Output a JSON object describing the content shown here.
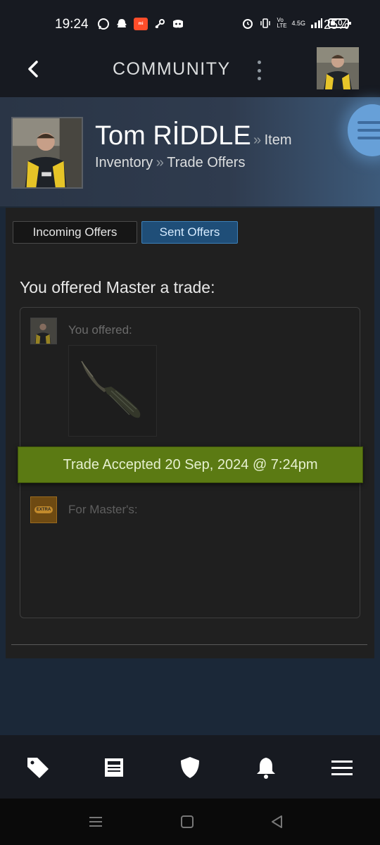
{
  "status_bar": {
    "time": "19:24",
    "network": "4.5G",
    "volte": "Vo LTE",
    "battery_percent": "25%",
    "mi_badge": "mi"
  },
  "header": {
    "title": "COMMUNITY"
  },
  "profile": {
    "name": "Tom RİDDLE",
    "separator": "»",
    "breadcrumb_1": "Item",
    "breadcrumb_2": "Inventory",
    "breadcrumb_3": "Trade Offers"
  },
  "tabs": {
    "incoming": "Incoming Offers",
    "sent": "Sent Offers",
    "active": "sent"
  },
  "offer": {
    "title": "You offered Master a trade:",
    "you_offered_label": "You offered:",
    "status": "Trade Accepted 20 Sep, 2024 @ 7:24pm",
    "for_label": "For Master's:",
    "partner_avatar_text": "EXTRA"
  },
  "colors": {
    "accent": "#1f4e78",
    "accepted_green": "#5b7a13",
    "background": "#1b2838"
  },
  "bottom_nav": [
    "tag-icon",
    "news-icon",
    "shield-icon",
    "bell-icon",
    "menu-icon"
  ]
}
